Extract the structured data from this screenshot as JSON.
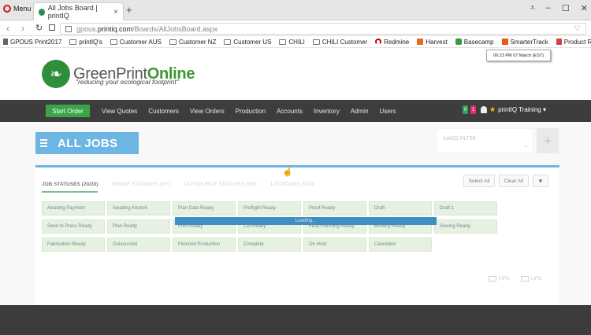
{
  "browser": {
    "menu_label": "Menu",
    "tab_title": "All Jobs Board | printIQ",
    "tab_close": "×",
    "new_tab": "+",
    "url_prefix": "gpous.",
    "url_domain": "printiq.com",
    "url_path": "/Boards/AllJobsBoard.aspx",
    "bookmarks": [
      "GPOUS Print2017",
      "printIQ's",
      "Customer AUS",
      "Customer NZ",
      "Customer US",
      "CHILI",
      "CHILI Customer",
      "Redmine",
      "Harvest",
      "Basecamp",
      "SmarterTrack",
      "Product Release Wor"
    ]
  },
  "header": {
    "timestamp": "06:23 PM  07 March (EST)",
    "logo_green": "GreenPrint",
    "logo_online": "Online",
    "tagline": "\"reducing your ecological footprint\""
  },
  "nav": {
    "start_order": "Start Order",
    "items": [
      "View Quotes",
      "Customers",
      "View Orders",
      "Production",
      "Accounts",
      "Inventory",
      "Admin",
      "Users"
    ],
    "badge_green": "0",
    "badge_pink": "1",
    "user_name": "printIQ Training ▾"
  },
  "board": {
    "title": "ALL JOBS",
    "saved_filter_label": "SAVED FILTER",
    "add_label": "+",
    "tabs": [
      "JOB STATUSES (20/20)",
      "PROOF STATUSES (0/7)",
      "OUTSOURCE STATUSES (0/5)",
      "LOCATIONS (0/20)"
    ],
    "select_all": "Select All",
    "clear_all": "Clear All",
    "statuses": [
      "Awaiting Payment",
      "Awaiting Artwork",
      "Plan Data Ready",
      "Preflight Ready",
      "Proof Ready",
      "Draft",
      "Draft 1",
      "Send to Press Ready",
      "Plan Ready",
      "Print Ready",
      "Cut Ready",
      "Final Finishing Ready",
      "Bindery Ready",
      "Sewing Ready",
      "Fabrication Ready",
      "Outsourced",
      "Finished Production",
      "Complete",
      "On Hold",
      "Cancelled"
    ],
    "view_fifo": "FIFO",
    "view_lifo": "LIFO",
    "loading": "Loading..."
  }
}
